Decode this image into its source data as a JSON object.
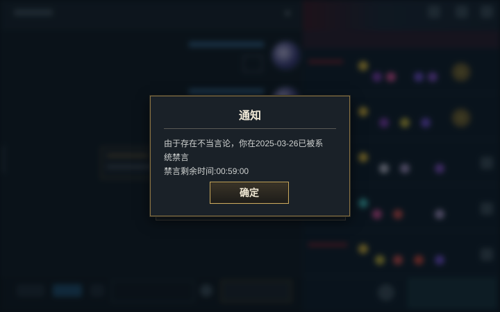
{
  "dialog": {
    "title": "通知",
    "message_line1": "由于存在不当言论，你在2025-03-26已被系",
    "message_line2": "统禁言",
    "remaining": "禁言剩余时间:00:59:00",
    "confirm_label": "确定"
  },
  "colors": {
    "accent_gold": "#c9a95e",
    "dialog_bg": "#1a2128",
    "background": "#0b121a"
  }
}
